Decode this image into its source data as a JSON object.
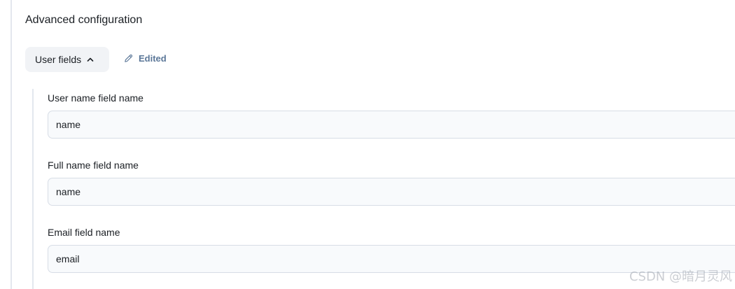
{
  "section": {
    "title": "Advanced configuration"
  },
  "toggle": {
    "label": "User fields",
    "icon": "chevron-up-icon",
    "expanded": true
  },
  "status": {
    "label": "Edited",
    "icon": "pencil-icon",
    "color": "#5b7798"
  },
  "fields": [
    {
      "label": "User name field name",
      "value": "name"
    },
    {
      "label": "Full name field name",
      "value": "name"
    },
    {
      "label": "Email field name",
      "value": "email"
    }
  ],
  "watermark": "CSDN @暗月灵风"
}
